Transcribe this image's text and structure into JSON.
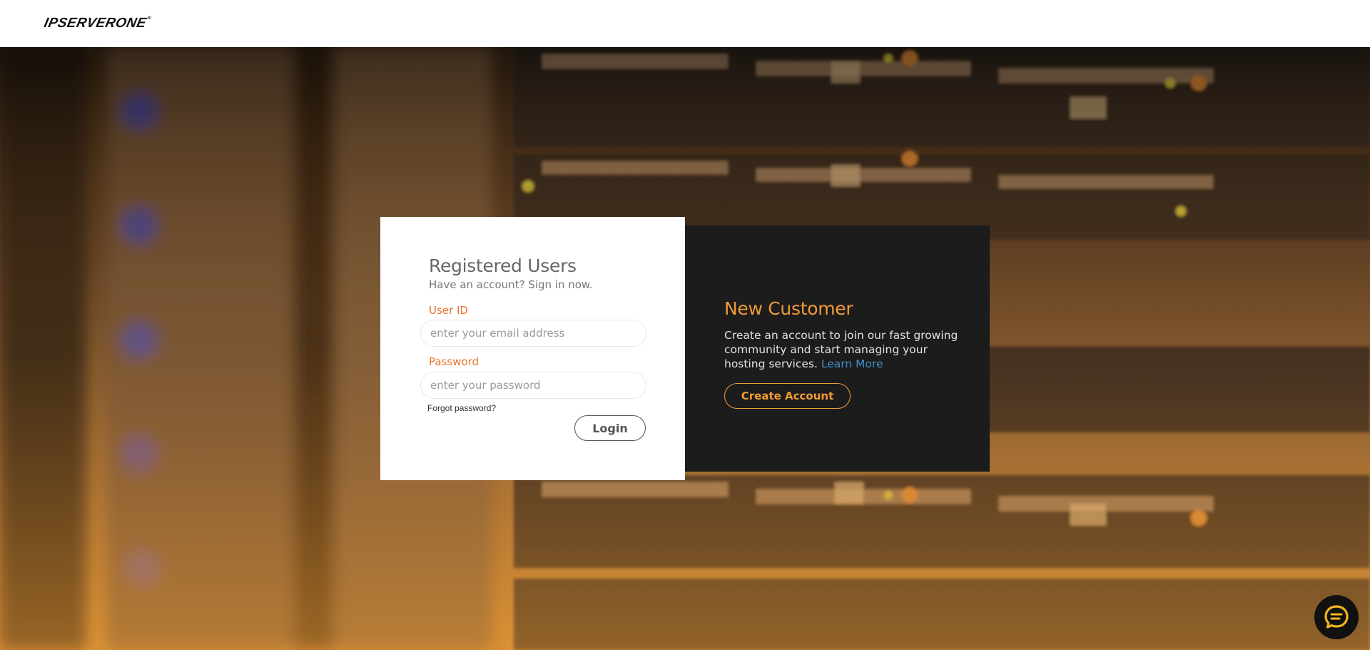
{
  "header": {
    "logo_text": "IPSERVERONE",
    "logo_mark": "®"
  },
  "login": {
    "title": "Registered Users",
    "subtitle": "Have an account? Sign in now.",
    "userid_label": "User ID",
    "userid_placeholder": "enter your email address",
    "password_label": "Password",
    "password_placeholder": "enter your password",
    "forgot_label": "Forgot password?",
    "login_label": "Login"
  },
  "customer": {
    "title": "New Customer",
    "description": "Create an account to join our fast growing community and start managing your hosting services.",
    "learn_more": "Learn More",
    "create_label": "Create Account"
  },
  "chat": {
    "icon": "chat-bubble-icon"
  },
  "colors": {
    "accent_orange": "#e8742b",
    "accent_amber": "#f09a35",
    "dark_panel": "#1c1c1d",
    "link_blue": "#3d8fc4"
  }
}
